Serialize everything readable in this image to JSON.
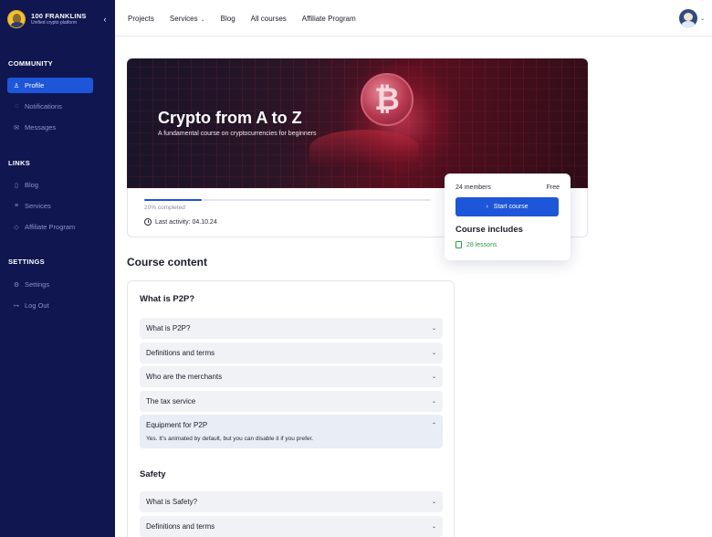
{
  "brand": {
    "name": "100 FRANKLINS",
    "tagline": "Unified crypto platform"
  },
  "sidebar": {
    "sections": [
      {
        "title": "COMMUNITY",
        "items": [
          {
            "label": "Profile",
            "icon": "user-icon",
            "active": true
          },
          {
            "label": "Notifications",
            "icon": "bell-icon"
          },
          {
            "label": "Messages",
            "icon": "mail-icon"
          }
        ]
      },
      {
        "title": "LINKS",
        "items": [
          {
            "label": "Blog",
            "icon": "document-icon"
          },
          {
            "label": "Services",
            "icon": "list-icon"
          },
          {
            "label": "Affiliate Program",
            "icon": "diamond-icon"
          }
        ]
      },
      {
        "title": "SETTINGS",
        "items": [
          {
            "label": "Settings",
            "icon": "gear-icon"
          },
          {
            "label": "Log Out",
            "icon": "logout-icon"
          }
        ]
      }
    ]
  },
  "topnav": {
    "links": [
      "Projects",
      "Services",
      "Blog",
      "All courses",
      "Affiliate Program"
    ]
  },
  "course": {
    "title": "Crypto from A to Z",
    "subtitle": "A fundamental course on cryptocurrencies for beginners",
    "progress_label": "20% completed",
    "progress_fraction": 0.2,
    "last_activity": "Last activity: 04.10.24",
    "members": "24 members",
    "price": "Free",
    "start_button": "Start course",
    "includes_title": "Course includes",
    "lessons": "28 lessons"
  },
  "content": {
    "title": "Course content",
    "sections": [
      {
        "title": "What is P2P?",
        "items": [
          {
            "label": "What is P2P?"
          },
          {
            "label": "Definitions and terms"
          },
          {
            "label": "Who are the merchants"
          },
          {
            "label": "The tax service"
          },
          {
            "label": "Equipment for P2P",
            "open": true,
            "body": "Yes. It's animated by default, but you can disable it if you prefer."
          }
        ]
      },
      {
        "title": "Safety",
        "items": [
          {
            "label": "What is Safety?"
          },
          {
            "label": "Definitions and terms"
          }
        ]
      }
    ]
  },
  "colors": {
    "sidebar": "#0f1650",
    "accent": "#1d56d8",
    "success": "#2e9b49"
  }
}
